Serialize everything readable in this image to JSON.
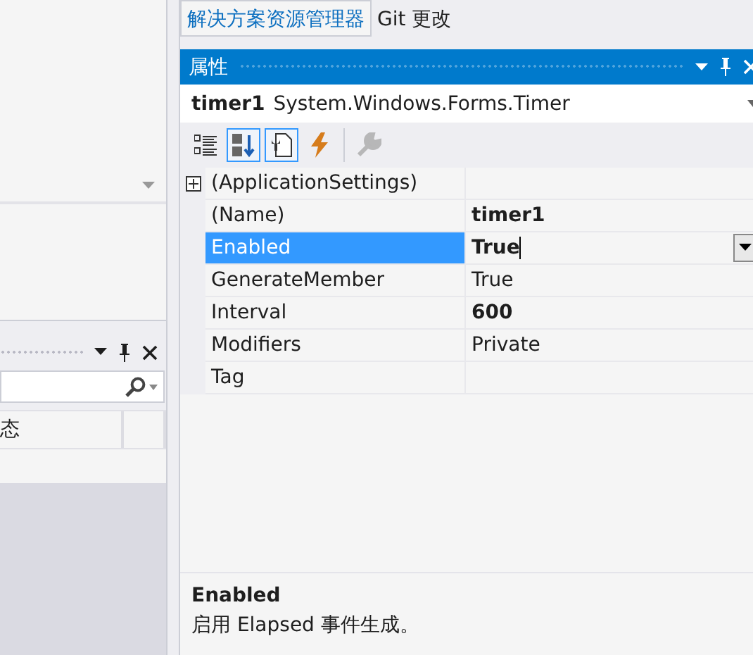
{
  "solution_tabs": [
    {
      "label": "解决方案资源管理器",
      "selected": true
    },
    {
      "label": "Git 更改",
      "selected": false
    }
  ],
  "left_panel": {
    "columns": [
      "态"
    ]
  },
  "properties": {
    "title": "属性",
    "object_name": "timer1",
    "object_type": "System.Windows.Forms.Timer",
    "toolbar": [
      {
        "kind": "categorized",
        "selected": false,
        "disabled": false
      },
      {
        "kind": "alphabetical",
        "selected": true,
        "disabled": false
      },
      {
        "kind": "properties",
        "selected": true,
        "disabled": false
      },
      {
        "kind": "events",
        "selected": false,
        "disabled": false
      },
      {
        "kind": "property-pages",
        "selected": false,
        "disabled": true
      }
    ],
    "rows": [
      {
        "kind": "category",
        "name": "(ApplicationSettings)",
        "expanded": false
      },
      {
        "kind": "property",
        "name": "(Name)",
        "value": "timer1",
        "modified": true,
        "selected": false
      },
      {
        "kind": "property",
        "name": "Enabled",
        "value": "True",
        "modified": true,
        "selected": true
      },
      {
        "kind": "property",
        "name": "GenerateMember",
        "value": "True",
        "modified": false,
        "selected": false
      },
      {
        "kind": "property",
        "name": "Interval",
        "value": "600",
        "modified": true,
        "selected": false
      },
      {
        "kind": "property",
        "name": "Modifiers",
        "value": "Private",
        "modified": false,
        "selected": false
      },
      {
        "kind": "property",
        "name": "Tag",
        "selected": false
      }
    ],
    "description": {
      "title": "Enabled",
      "text": "启用 Elapsed 事件生成。"
    }
  }
}
